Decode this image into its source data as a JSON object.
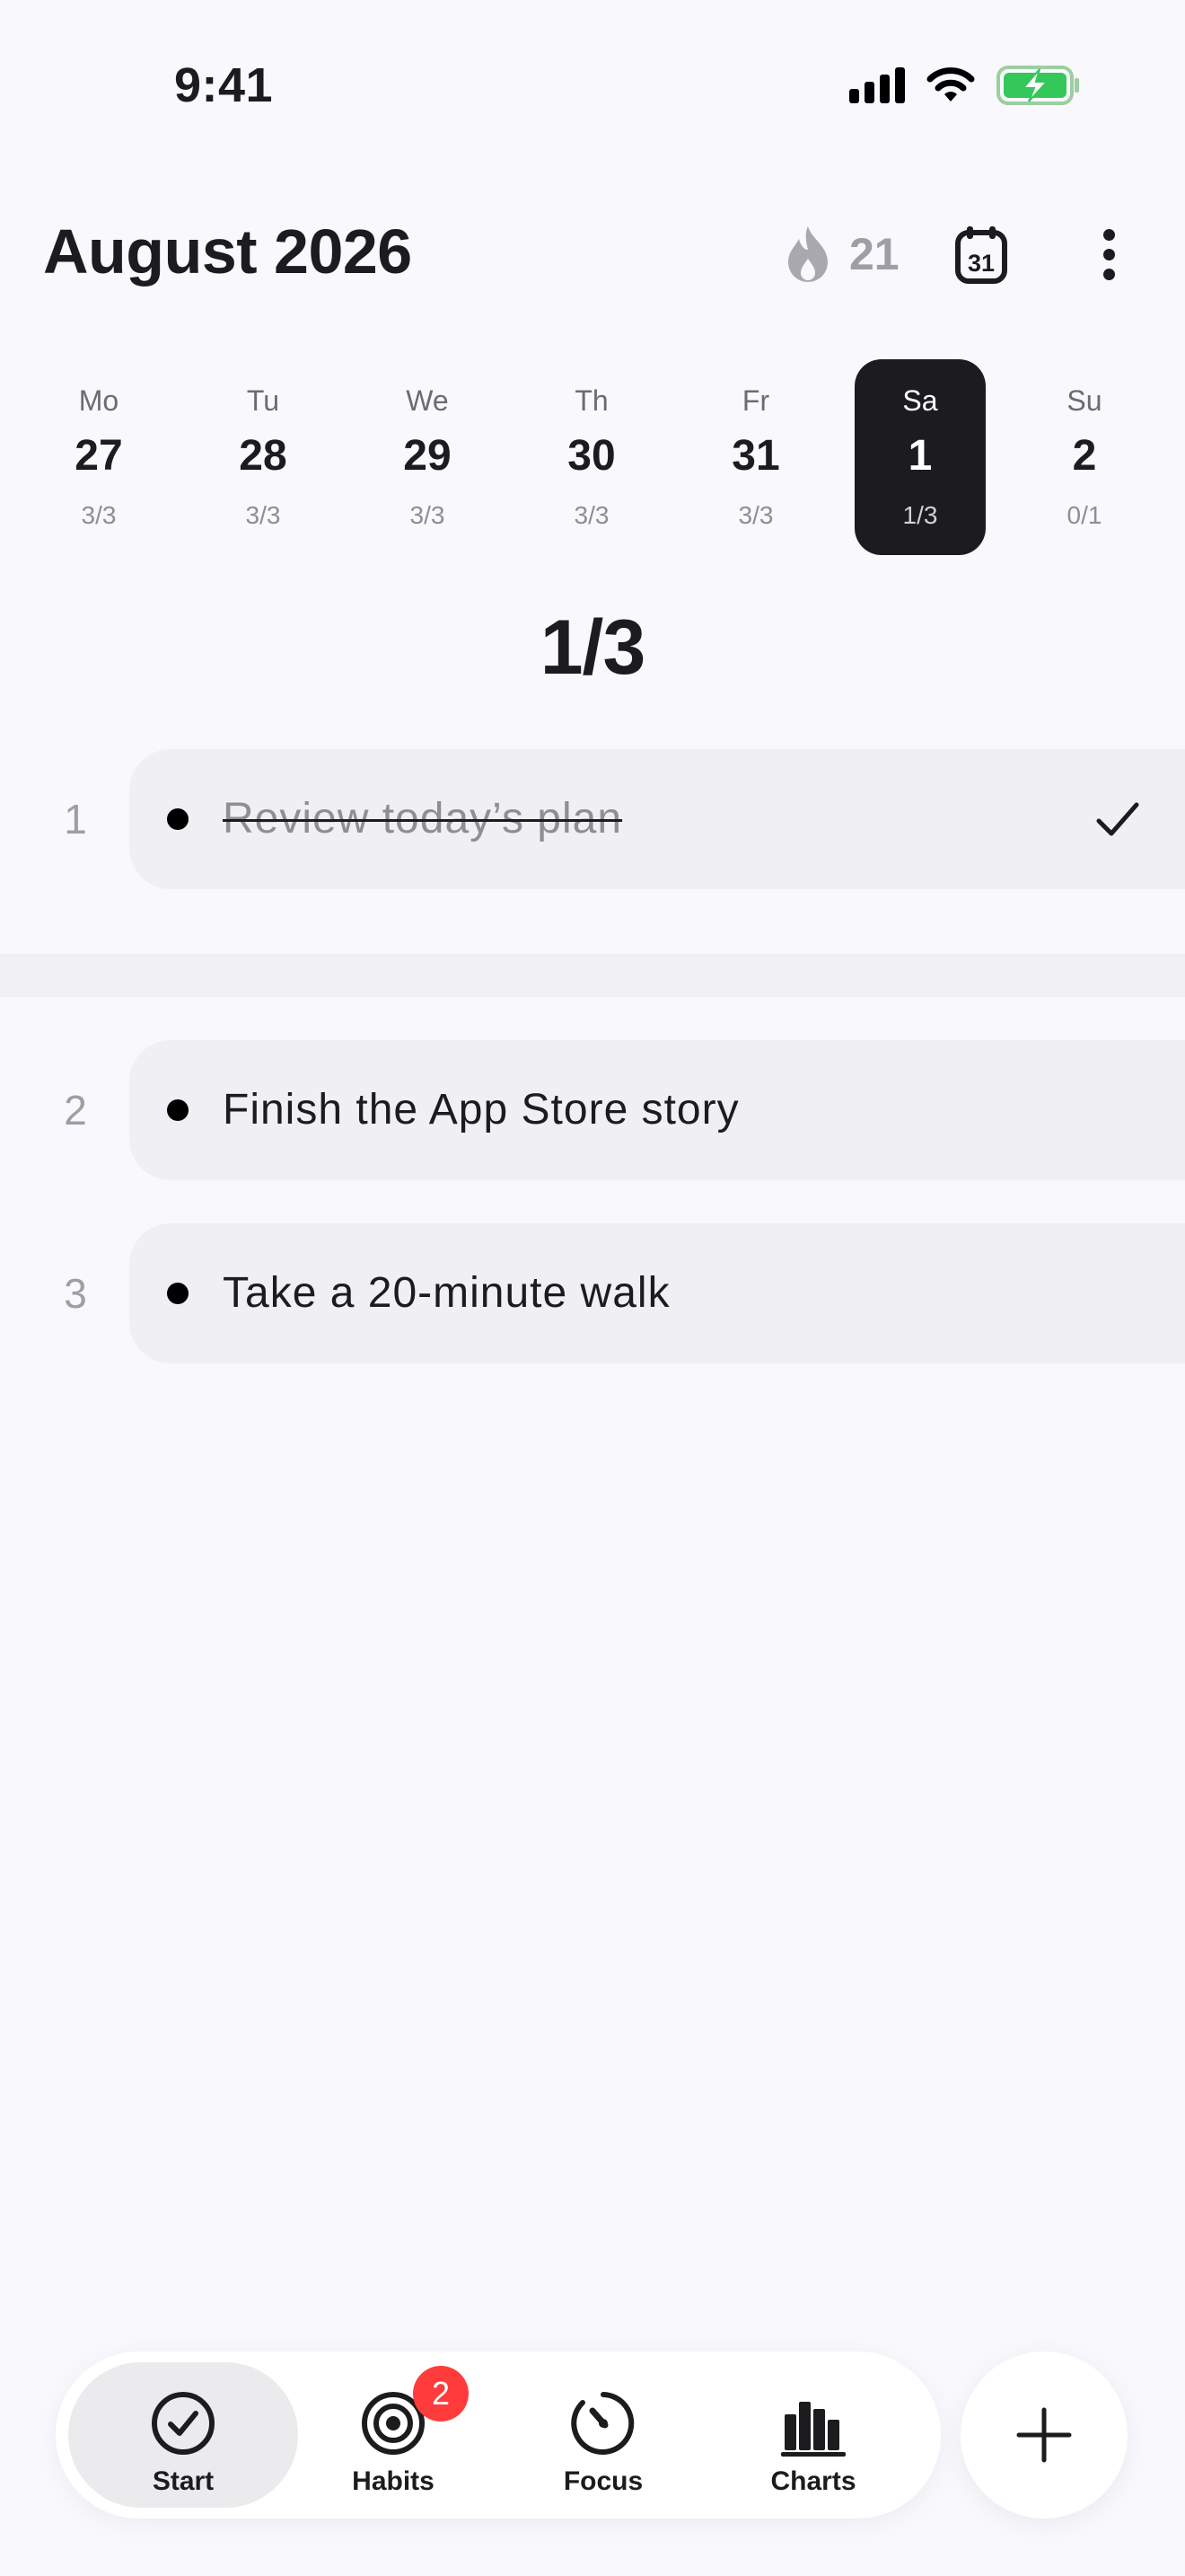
{
  "status_bar": {
    "time": "9:41"
  },
  "header": {
    "title": "August 2026",
    "streak_count": "21"
  },
  "week": [
    {
      "name": "Mo",
      "number": "27",
      "progress": "3/3",
      "selected": false
    },
    {
      "name": "Tu",
      "number": "28",
      "progress": "3/3",
      "selected": false
    },
    {
      "name": "We",
      "number": "29",
      "progress": "3/3",
      "selected": false
    },
    {
      "name": "Th",
      "number": "30",
      "progress": "3/3",
      "selected": false
    },
    {
      "name": "Fr",
      "number": "31",
      "progress": "3/3",
      "selected": false
    },
    {
      "name": "Sa",
      "number": "1",
      "progress": "1/3",
      "selected": true
    },
    {
      "name": "Su",
      "number": "2",
      "progress": "0/1",
      "selected": false
    }
  ],
  "progress_summary": "1/3",
  "tasks": [
    {
      "number": "1",
      "text": "Review today’s plan",
      "done": true
    },
    {
      "number": "2",
      "text": "Finish the App Store story",
      "done": false
    },
    {
      "number": "3",
      "text": "Take a 20-minute walk",
      "done": false
    }
  ],
  "tabs": [
    {
      "label": "Start",
      "icon": "check-circle-icon",
      "active": true
    },
    {
      "label": "Habits",
      "icon": "target-icon",
      "active": false,
      "badge": "2"
    },
    {
      "label": "Focus",
      "icon": "timer-icon",
      "active": false
    },
    {
      "label": "Charts",
      "icon": "bar-chart-icon",
      "active": false
    }
  ],
  "calendar_icon_day": "31",
  "colors": {
    "accent_dark": "#1C1C20",
    "badge_red": "#FF3B3B",
    "battery_green": "#34C759",
    "muted": "#9E9EA4"
  }
}
